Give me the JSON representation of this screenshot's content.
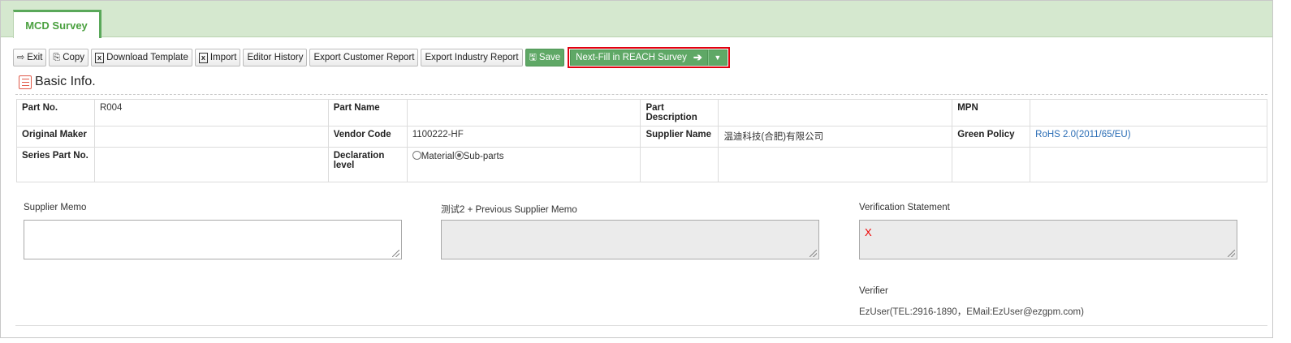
{
  "tab": {
    "label": "MCD Survey"
  },
  "toolbar": {
    "exit": "Exit",
    "copy": "Copy",
    "download_template": "Download Template",
    "import": "Import",
    "editor_history": "Editor History",
    "export_customer_report": "Export Customer Report",
    "export_industry_report": "Export Industry Report",
    "save": "Save",
    "next_fill": "Next-Fill in REACH Survey"
  },
  "section": {
    "title": "Basic Info."
  },
  "info": {
    "part_no_label": "Part No.",
    "part_no": "R004",
    "part_name_label": "Part Name",
    "part_name": "",
    "part_desc_label": "Part Description",
    "part_desc": "",
    "mpn_label": "MPN",
    "mpn": "",
    "original_maker_label": "Original Maker",
    "original_maker": "",
    "vendor_code_label": "Vendor Code",
    "vendor_code": "1100222-HF",
    "supplier_name_label": "Supplier Name",
    "supplier_name": "温迪科技(合肥)有限公司",
    "green_policy_label": "Green Policy",
    "green_policy": "RoHS 2.0(2011/65/EU)",
    "series_part_no_label": "Series Part No.",
    "series_part_no": "",
    "declaration_level_label": "Declaration level",
    "declaration_options": [
      "Material",
      "Sub-parts"
    ],
    "declaration_selected": "Sub-parts"
  },
  "memos": {
    "supplier_memo_label": "Supplier Memo",
    "supplier_memo_value": "",
    "previous_memo_label": "测试2 + Previous Supplier Memo",
    "previous_memo_value": "",
    "verification_label": "Verification Statement",
    "verification_value": "X"
  },
  "verifier": {
    "label": "Verifier",
    "value": "EzUser(TEL:2916-1890，EMail:EzUser@ezgpm.com)"
  },
  "colors": {
    "accent_green": "#5fa866",
    "highlight_red": "#e0000f",
    "tab_bar": "#d5e8cf"
  }
}
